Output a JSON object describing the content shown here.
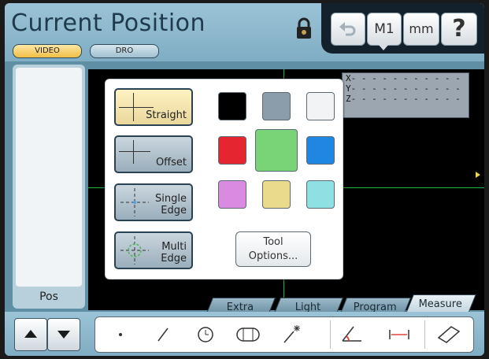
{
  "header": {
    "title": "Current Position",
    "modes": [
      {
        "label": "VIDEO",
        "active": true
      },
      {
        "label": "DRO",
        "active": false
      }
    ],
    "buttons": {
      "undo_icon": "undo-icon",
      "measure_unit_m": "M1",
      "unit": "mm",
      "help": "?"
    }
  },
  "left_panel": {
    "label": "Pos"
  },
  "readout": {
    "x": "X- - - - - - - - - - -",
    "y": "Y- - - - - - - - - - -",
    "z": "Z- - - - - - - - - - -"
  },
  "edge_tools": [
    {
      "label": "Straight",
      "icon": "straight-crosshair-icon",
      "selected": true
    },
    {
      "label": "Offset",
      "icon": "offset-crosshair-icon",
      "selected": false
    },
    {
      "label_line1": "Single",
      "label_line2": "Edge",
      "icon": "single-edge-icon",
      "selected": false
    },
    {
      "label_line1": "Multi",
      "label_line2": "Edge",
      "icon": "multi-edge-icon",
      "selected": false
    }
  ],
  "colors": [
    {
      "name": "black",
      "hex": "#000000"
    },
    {
      "name": "gray",
      "hex": "#8b9cab"
    },
    {
      "name": "white",
      "hex": "#f1f3f4"
    },
    {
      "name": "red",
      "hex": "#e5252f"
    },
    {
      "name": "green",
      "hex": "#79d377",
      "selected": true
    },
    {
      "name": "blue",
      "hex": "#1f86e2"
    },
    {
      "name": "violet",
      "hex": "#d98be2"
    },
    {
      "name": "yellow",
      "hex": "#eadb8c"
    },
    {
      "name": "cyan",
      "hex": "#8fe0e3"
    }
  ],
  "tool_options": {
    "line1": "Tool",
    "line2": "Options..."
  },
  "tabs": [
    {
      "label": "Extra",
      "active": false
    },
    {
      "label": "Light",
      "active": false
    },
    {
      "label": "Program",
      "active": false
    },
    {
      "label": "Measure",
      "active": true
    }
  ],
  "measure_tools": [
    "point-icon",
    "line-icon",
    "circle-icon",
    "slot-icon",
    "wand-icon",
    "angle-icon",
    "distance-icon",
    "rectangle-icon"
  ],
  "accent_colors": {
    "crosshair": "#22b53e",
    "active_mode": "#f0be45"
  }
}
